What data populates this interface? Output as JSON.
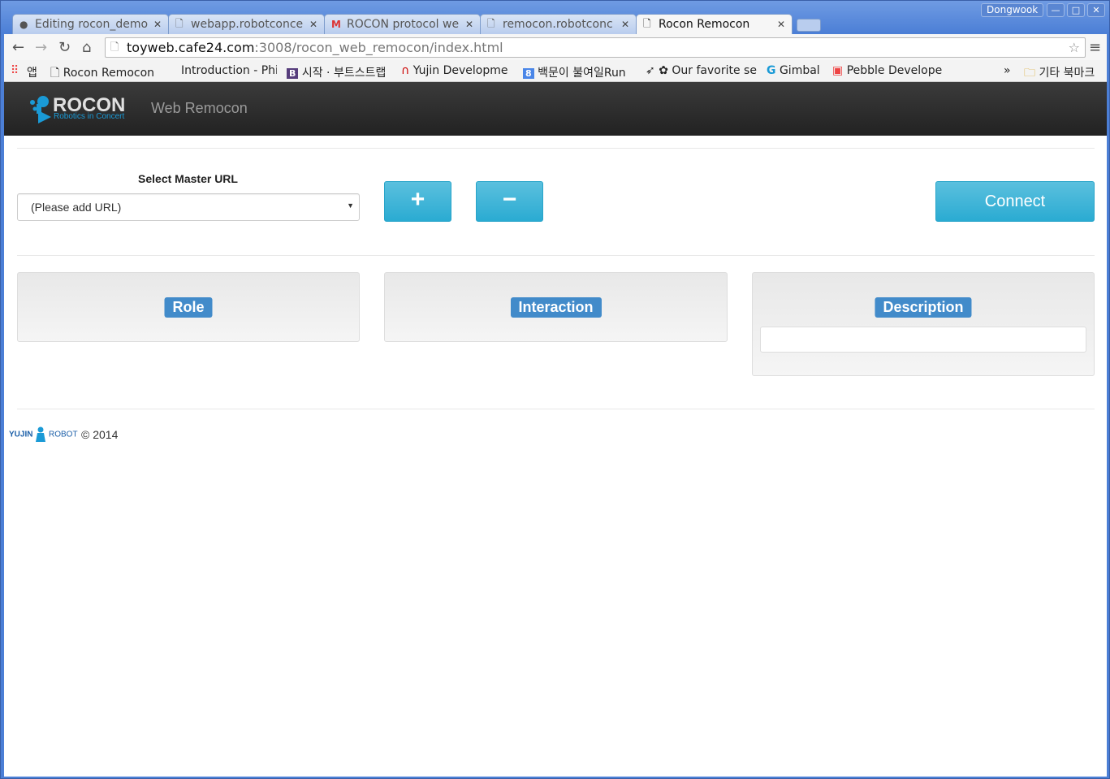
{
  "browser": {
    "tabs": [
      {
        "title": "Editing rocon_demo",
        "icon": "github-icon",
        "active": false
      },
      {
        "title": "webapp.robotconce",
        "icon": "page-icon",
        "active": false
      },
      {
        "title": "ROCON protocol we",
        "icon": "gmail-icon",
        "active": false
      },
      {
        "title": "remocon.robotconc",
        "icon": "page-icon",
        "active": false
      },
      {
        "title": "Rocon Remocon",
        "icon": "page-icon",
        "active": true
      }
    ],
    "user": "Dongwook",
    "url_host": "toyweb.cafe24.com",
    "url_rest": ":3008/rocon_web_remocon/index.html",
    "bookmarks": [
      "앱",
      "Rocon Remocon",
      "Introduction - Phi",
      "시작 · 부트스트랩",
      "Yujin Developme",
      "백문이 불여일Run",
      "✿ Our favorite se",
      "Gimbal",
      "Pebble Develope"
    ],
    "bookmarks_overflow": "»",
    "other_bookmarks": "기타 북마크"
  },
  "header": {
    "brand": "ROCON",
    "brand_sub": "Robotics in Concert",
    "app_title": "Web Remocon"
  },
  "master": {
    "label": "Select Master URL",
    "selected": "(Please add URL)",
    "add_label": "+",
    "remove_label": "−",
    "connect_label": "Connect"
  },
  "panels": {
    "role": "Role",
    "interaction": "Interaction",
    "description": "Description"
  },
  "footer": {
    "company": "YUJIN ROBOT",
    "copyright": "© 2014"
  },
  "colors": {
    "accent": "#5bc0de",
    "badge": "#428bca",
    "navbar": "#2b2b2b"
  }
}
